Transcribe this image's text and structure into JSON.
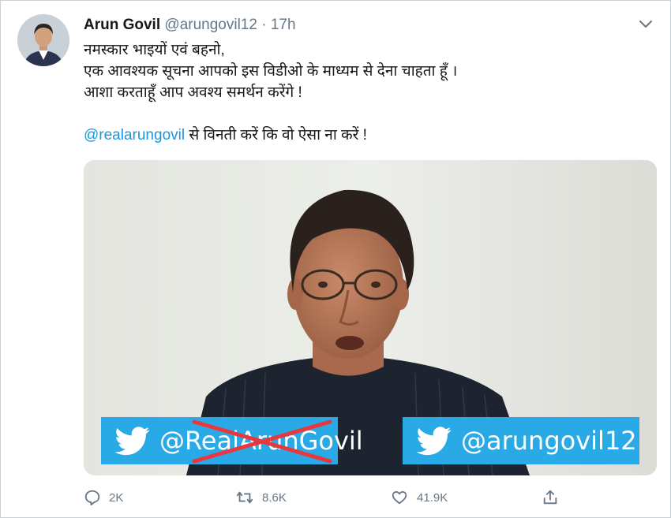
{
  "tweet": {
    "author_name": "Arun Govil",
    "author_handle": "@arungovil12",
    "separator": "·",
    "time": "17h",
    "lines": [
      "नमस्कार भाइयों एवं बहनो,",
      "एक आवश्यक सूचना आपको इस विडीओ के माध्यम से देना चाहता हूँ ।",
      "आशा करताहूँ आप अवश्य समर्थन करेंगे !"
    ],
    "mention": "@realarungovil",
    "mention_suffix": " से विनती करें कि वो ऐसा ना करें !"
  },
  "media": {
    "old_handle": "@RealArunGovil",
    "new_handle": "@arungovil12",
    "banner_color": "#29a9e6",
    "cross_color": "#e8373d"
  },
  "actions": {
    "reply_count": "2K",
    "retweet_count": "8.6K",
    "like_count": "41.9K"
  },
  "colors": {
    "link": "#1b95e0",
    "muted": "#657786"
  }
}
